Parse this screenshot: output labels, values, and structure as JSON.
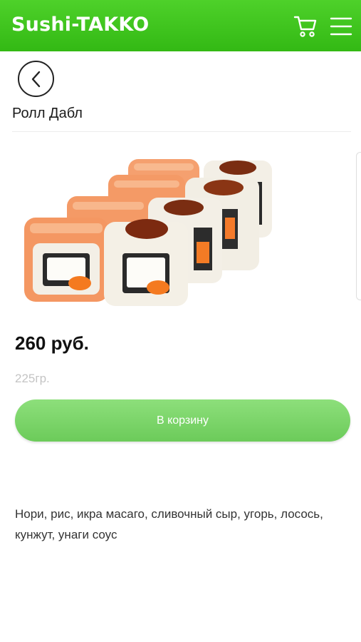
{
  "header": {
    "brand": "Sushi-TAKKO",
    "cart_icon": "cart-icon",
    "menu_icon": "hamburger-menu-icon"
  },
  "navigation": {
    "back_icon": "chevron-left-icon"
  },
  "product": {
    "title": "Ролл Дабл",
    "price": "260 руб.",
    "weight": "225гр.",
    "add_to_cart_label": "В корзину",
    "description": "Нори, рис, икра масаго, сливочный сыр, угорь, лосось, кунжут, унаги соус"
  },
  "colors": {
    "header_green": "#3fc61e",
    "button_green": "#7dd66a",
    "salmon": "#f59a6b"
  }
}
